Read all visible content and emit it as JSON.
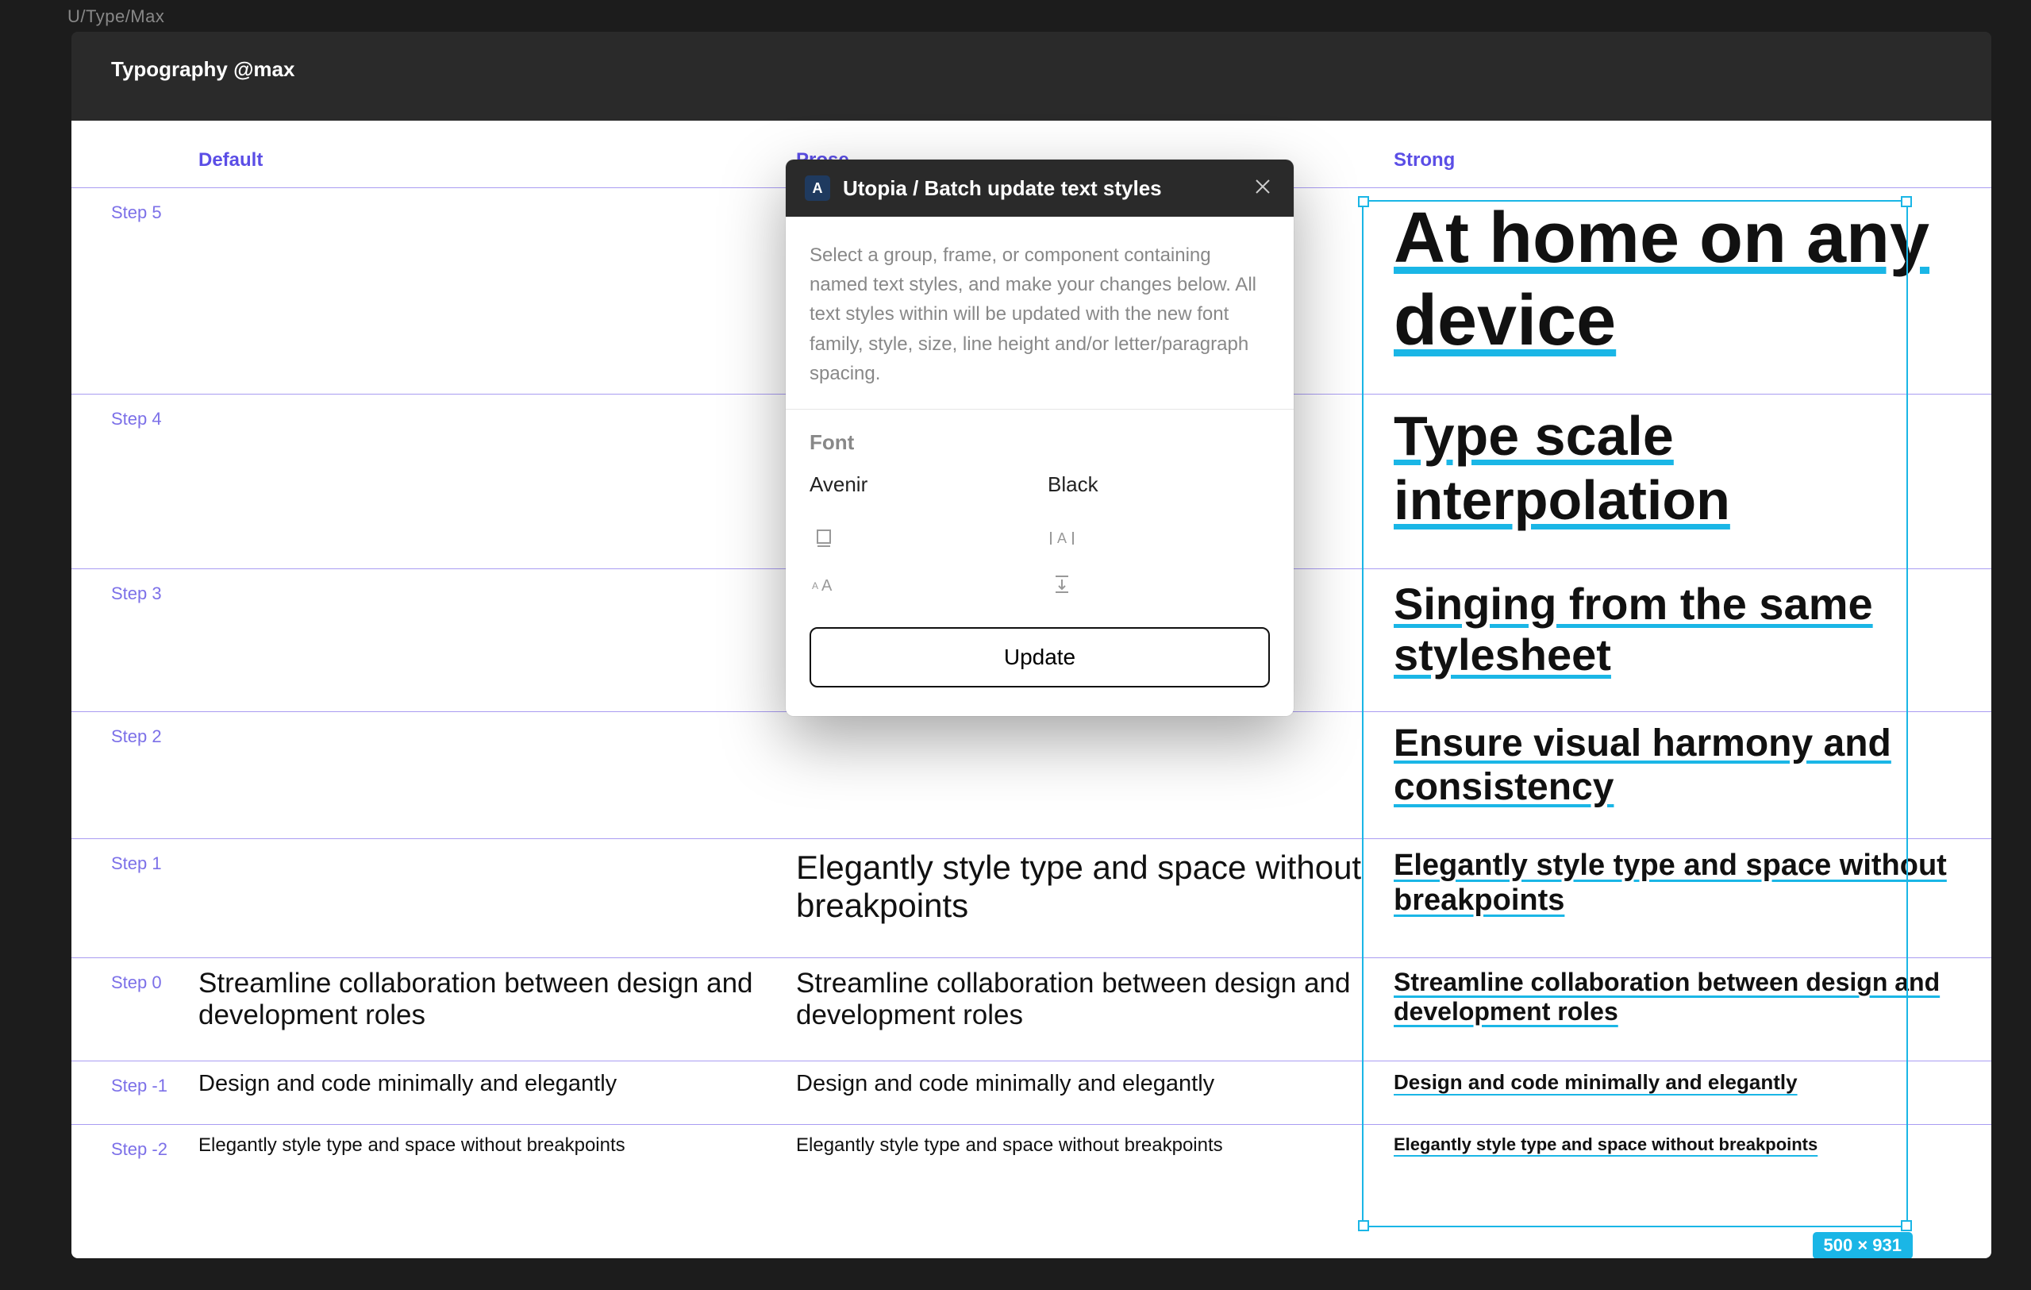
{
  "breadcrumb": "U/Type/Max",
  "frame_title": "Typography @max",
  "columns": [
    "Default",
    "Prose",
    "Strong"
  ],
  "steps": [
    {
      "label": "Step 5",
      "default": "",
      "prose": "",
      "strong": "At home on any device"
    },
    {
      "label": "Step 4",
      "default": "",
      "prose": "",
      "strong": "Type scale interpolation"
    },
    {
      "label": "Step 3",
      "default": "",
      "prose": "",
      "strong": "Singing from the same stylesheet"
    },
    {
      "label": "Step 2",
      "default": "",
      "prose": "",
      "strong": "Ensure visual harmony and consistency"
    },
    {
      "label": "Step 1",
      "default": "",
      "prose": "Elegantly style type and space without breakpoints",
      "strong": "Elegantly style type and space without breakpoints"
    },
    {
      "label": "Step 0",
      "default": "Streamline collaboration between design and development roles",
      "prose": "Streamline collaboration between design and development roles",
      "strong": "Streamline collaboration between design and development roles"
    },
    {
      "label": "Step -1",
      "default": "Design and code minimally and elegantly",
      "prose": "Design and code minimally and elegantly",
      "strong": "Design and code minimally and elegantly"
    },
    {
      "label": "Step -2",
      "default": "Elegantly style type and space without breakpoints",
      "prose": "Elegantly style type and space without breakpoints",
      "strong": "Elegantly style type and space without breakpoints"
    }
  ],
  "selection_dims": "500 × 931",
  "modal": {
    "title": "Utopia / Batch update text styles",
    "description": "Select a group, frame, or component containing named text styles, and make your changes below. All text styles within will be updated with the new font family, style, size, line height and/or letter/paragraph spacing.",
    "font_section_label": "Font",
    "font_family": "Avenir",
    "font_weight": "Black",
    "update_label": "Update"
  }
}
